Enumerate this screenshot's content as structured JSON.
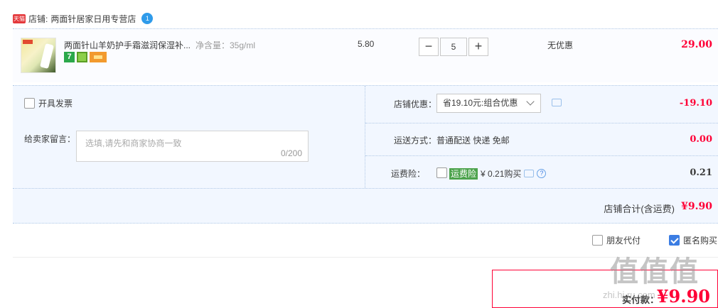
{
  "shop": {
    "badge": "天猫",
    "label": "店铺:",
    "name": "两面针居家日用专营店",
    "chat_badge": "1"
  },
  "item": {
    "title": "两面针山羊奶护手霜滋润保湿补...",
    "spec": "净含量：35g/ml",
    "badge_seven": "7",
    "unit_price": "5.80",
    "quantity": "5",
    "minus": "−",
    "plus": "+",
    "discount": "无优惠",
    "subtotal": "29.00"
  },
  "order": {
    "invoice_label": "开具发票",
    "memo_label": "给卖家留言：",
    "memo_placeholder": "选填,请先和商家协商一致",
    "memo_count": "0/200",
    "coupon_label": "店铺优惠：",
    "coupon_value": "省19.10元:组合优惠",
    "coupon_amount": "-19.10",
    "shipping_label": "运送方式：",
    "shipping_value": "普通配送 快递 免邮",
    "shipping_amount": "0.00",
    "insurance_label": "运费险：",
    "insurance_tag": "运费险",
    "insurance_price": "¥ 0.21购买",
    "insurance_amount": "0.21",
    "total_label": "店铺合计(含运费)",
    "total_value": "¥9.90"
  },
  "options": {
    "friend_pay": "朋友代付",
    "anonymous": "匿名购买"
  },
  "payment": {
    "label": "实付款：",
    "value": "¥9.90"
  },
  "watermark": {
    "text": "值值值",
    "sub": "zhi.hi.ru.com"
  },
  "colors": {
    "price_red": "#ff0036",
    "accent_blue": "#3b7de3",
    "panel_bg": "#f2f7ff"
  }
}
